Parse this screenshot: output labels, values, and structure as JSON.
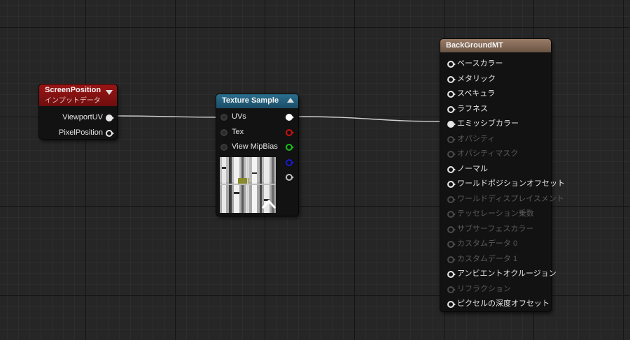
{
  "nodes": {
    "screen_position": {
      "title": "ScreenPosition",
      "subtitle": "インプットデータ",
      "outputs": [
        "ViewportUV",
        "PixelPosition"
      ]
    },
    "texture_sample": {
      "title": "Texture Sample",
      "inputs": [
        "UVs",
        "Tex",
        "View MipBias"
      ],
      "output_colors": [
        "#ffffff",
        "#cc1010",
        "#18c018",
        "#1a1ad0",
        "#bdbdbd"
      ]
    },
    "material": {
      "title": "BackGroundMT",
      "inputs": [
        {
          "label": "ベースカラー",
          "enabled": true,
          "connected": false
        },
        {
          "label": "メタリック",
          "enabled": true,
          "connected": false
        },
        {
          "label": "スペキュラ",
          "enabled": true,
          "connected": false
        },
        {
          "label": "ラフネス",
          "enabled": true,
          "connected": false
        },
        {
          "label": "エミッシブカラー",
          "enabled": true,
          "connected": true
        },
        {
          "label": "オパシティ",
          "enabled": false,
          "connected": false
        },
        {
          "label": "オパシティマスク",
          "enabled": false,
          "connected": false
        },
        {
          "label": "ノーマル",
          "enabled": true,
          "connected": false
        },
        {
          "label": "ワールドポジションオフセット",
          "enabled": true,
          "connected": false
        },
        {
          "label": "ワールドディスプレイスメント",
          "enabled": false,
          "connected": false
        },
        {
          "label": "テッセレーション乗数",
          "enabled": false,
          "connected": false
        },
        {
          "label": "サブサーフェスカラー",
          "enabled": false,
          "connected": false
        },
        {
          "label": "カスタムデータ 0",
          "enabled": false,
          "connected": false
        },
        {
          "label": "カスタムデータ 1",
          "enabled": false,
          "connected": false
        },
        {
          "label": "アンビエントオクルージョン",
          "enabled": true,
          "connected": false
        },
        {
          "label": "リフラクション",
          "enabled": false,
          "connected": false
        },
        {
          "label": "ピクセルの深度オフセット",
          "enabled": true,
          "connected": false
        }
      ]
    }
  },
  "colors": {
    "graph_background": "#262626",
    "wire": "#d0d0d0",
    "screen_position_header": "#9b1515",
    "texture_sample_header": "#2a6f8e",
    "material_header": "#9a7c67"
  }
}
